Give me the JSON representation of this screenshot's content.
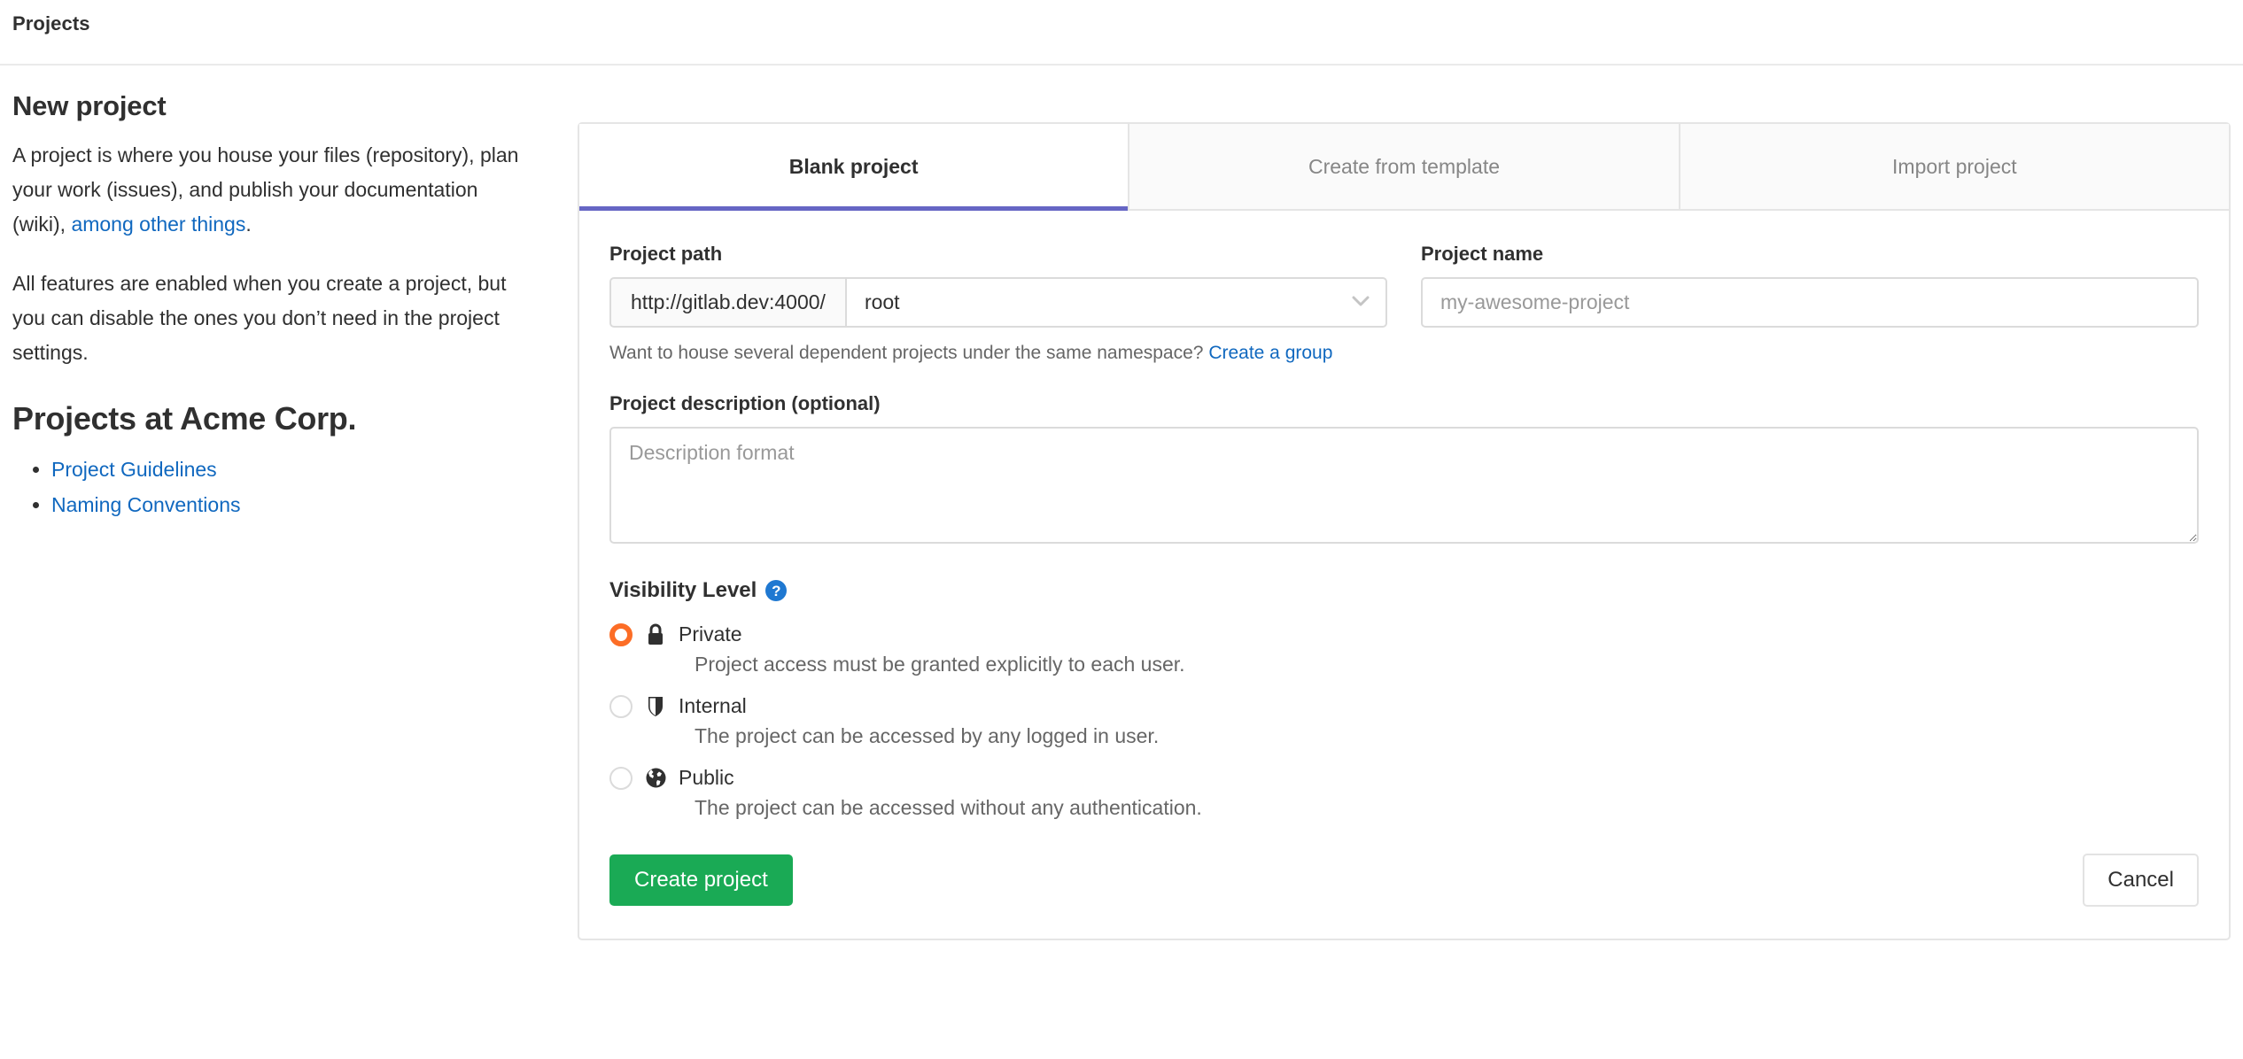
{
  "breadcrumb": {
    "label": "Projects"
  },
  "intro": {
    "title": "New project",
    "paragraph1_part1": "A project is where you house your files (repository), plan your work (issues), and publish your documentation (wiki), ",
    "paragraph1_link": "among other things",
    "paragraph1_part2": ".",
    "paragraph2": "All features are enabled when you create a project, but you can disable the ones you don’t need in the project settings.",
    "section_title": "Projects at Acme Corp.",
    "links": [
      {
        "label": "Project Guidelines"
      },
      {
        "label": "Naming Conventions"
      }
    ]
  },
  "tabs": [
    {
      "label": "Blank project",
      "active": true
    },
    {
      "label": "Create from template",
      "active": false
    },
    {
      "label": "Import project",
      "active": false
    }
  ],
  "form": {
    "project_path": {
      "label": "Project path",
      "prefix": "http://gitlab.dev:4000/",
      "namespace_selected": "root",
      "chevron_icon": "chevron-down-icon"
    },
    "project_name": {
      "label": "Project name",
      "value": "",
      "placeholder": "my-awesome-project"
    },
    "namespace_help": {
      "text": "Want to house several dependent projects under the same namespace? ",
      "link": "Create a group"
    },
    "description": {
      "label": "Project description (optional)",
      "value": "",
      "placeholder": "Description format"
    },
    "visibility": {
      "label": "Visibility Level",
      "help_icon": "question-mark-icon",
      "help_glyph": "?",
      "options": [
        {
          "name": "Private",
          "icon": "lock-icon",
          "description": "Project access must be granted explicitly to each user.",
          "selected": true
        },
        {
          "name": "Internal",
          "icon": "shield-icon",
          "description": "The project can be accessed by any logged in user.",
          "selected": false
        },
        {
          "name": "Public",
          "icon": "globe-icon",
          "description": "The project can be accessed without any authentication.",
          "selected": false
        }
      ]
    },
    "actions": {
      "submit_label": "Create project",
      "cancel_label": "Cancel"
    }
  },
  "colors": {
    "accent_green": "#1aaa55",
    "accent_orange": "#fc6d26",
    "link_blue": "#1068bf",
    "tab_indigo": "#6666c4",
    "help_blue": "#1f78d1"
  }
}
